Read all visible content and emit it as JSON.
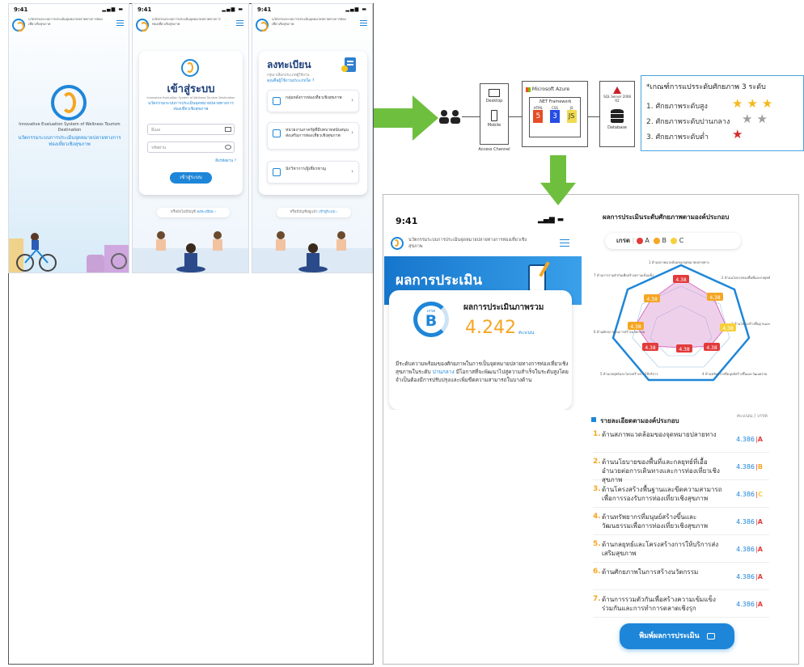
{
  "phone1": {
    "time": "9:41",
    "app_name": "นวัตกรรมระบบการประเมินจุดหมายปลายทางการท่องเที่ยวเชิงสุขภาพ",
    "system_en": "Innovative Evaluation System of Wellness Tourism Destination",
    "system_th": "นวัตกรรมระบบการประเมินจุดหมายปลายทางการท่องเที่ยวเชิงสุขภาพ"
  },
  "phone2": {
    "time": "9:41",
    "title": "เข้าสู่ระบบ",
    "subtitle_en": "Innovative Evaluation System of Wellness Tourism Destination",
    "subtitle_th": "นวัตกรรมระบบการประเมินจุดหมายปลายทางการท่องเที่ยวเชิงสุขภาพ",
    "email_placeholder": "อีเมล",
    "password_placeholder": "รหัสผ่าน",
    "forgot": "ลืมรหัสผ่าน ?",
    "login_button": "เข้าสู่ระบบ",
    "register_prompt": "หรือยังไม่มีบัญชี",
    "register_link": "ลงทะเบียน"
  },
  "phone3": {
    "time": "9:41",
    "title": "ลงทะเบียน",
    "subtitle": "กรุณาเลือกประเภทผู้ใช้งาน",
    "question": "คุณคือผู้ใช้งานประเภทใด ?",
    "options": [
      "กลุ่มหลังการท่องเที่ยวเชิงสุขภาพ",
      "หน่วยงานภาครัฐที่มีบทบาทสนับสนุน ส่งเสริมการท่องเที่ยวเชิงสุขภาพ",
      "นักวิชาการ/ผู้เชี่ยวชาญ"
    ],
    "login_prompt": "หรือมีบัญชีอยู่แล้ว",
    "login_link": "เข้าสู่ระบบ"
  },
  "architecture": {
    "desktop": "Desktop",
    "mobile": "Mobile",
    "access_channel": "Access Channel",
    "azure": "Microsoft Azure",
    "net": ".NET Framework",
    "html": "HTML",
    "css": "CSS",
    "js": "JS",
    "sql": "SQL Server 2008 R2",
    "database": "Database"
  },
  "legend": {
    "title": "*เกณฑ์การแปรระดับศักยภาพ 3 ระดับ",
    "levels": [
      "1. ศักยภาพระดับสูง",
      "2. ศักยภาพระดับปานกลาง",
      "3. ศักยภาพระดับต่ำ"
    ],
    "colors": {
      "gold": "#f5b81c",
      "gray": "#9e9e9e",
      "red": "#d62b2b"
    }
  },
  "result_phone": {
    "time": "9:41",
    "app_name": "นวัตกรรมระบบการประเมินจุดหมายปลายทางการท่องเที่ยวเชิงสุขภาพ",
    "banner": "ผลการประเมิน",
    "grade_label": "เกรด",
    "grade": "B",
    "overall_title": "ผลการประเมินภาพรวม",
    "score": "4.242",
    "unit": "คะแนน",
    "description_1": "มีระดับความพร้อมของศักยภาพในการเป็นจุดหมายปลายทางการท่องเที่ยวเชิงสุขภาพในระดับ",
    "description_level": "ปานกลาง",
    "description_2": "มีโอกาสที่จะพัฒนาไปสู่ความสำเร็จในระดับสูงโดยจำเป็นต้องมีการปรับปรุงและเพิ่มขีดความสามารถในบางด้าน"
  },
  "component": {
    "title": "ผลการประเมินระดับศักยภาพตามองค์ประกอบ",
    "grade_label": "เกรด",
    "grades": [
      "A",
      "B",
      "C"
    ],
    "grade_colors": [
      "#e23b3b",
      "#f5a623",
      "#f7d03c"
    ],
    "radar_labels": [
      "1 ด้านสภาพแวดล้อมของจุดหมายปลายทาง",
      "2 ด้านนโยบายของพื้นที่และกลยุทธ์ที่เอื้อต่อ",
      "3 ด้านโครงสร้างพื้นฐานและขีดความสามารถ",
      "4 ด้านทรัพยากรที่มนุษย์สร้างขึ้นและวัฒนธรรม",
      "5 ด้านกลยุทธ์และโครงสร้างการให้บริการ",
      "6 ด้านศักยภาพในการสร้างนวัตกรรม",
      "7 ด้านการรวมตัวกันเพื่อสร้างความเข้มแข็ง"
    ],
    "radar_values": [
      "4.38",
      "4.38",
      "4.38",
      "4.38",
      "4.38",
      "4.38",
      "4.38",
      "4.38"
    ],
    "detail_title": "รายละเอียดตามองค์ประกอบ",
    "detail_header": "คะแนน / เกรด",
    "rows": [
      {
        "num": "1.",
        "text": "ด้านสภาพแวดล้อมของจุดหมายปลายทาง",
        "score": "4.386",
        "grade": "A"
      },
      {
        "num": "2.",
        "text": "ด้านนโยบายของพื้นที่และกลยุทธ์ที่เอื้ออำนวยต่อการเดินทางและการท่องเที่ยวเชิงสุขภาพ",
        "score": "4.386",
        "grade": "B"
      },
      {
        "num": "3.",
        "text": "ด้านโครงสร้างพื้นฐานและขีดความสามารถเพื่อการรองรับการท่องเที่ยวเชิงสุขภาพ",
        "score": "4.386",
        "grade": "C"
      },
      {
        "num": "4.",
        "text": "ด้านทรัพยากรที่มนุษย์สร้างขึ้นและวัฒนธรรมเพื่อการท่องเที่ยวเชิงสุขภาพ",
        "score": "4.386",
        "grade": "A"
      },
      {
        "num": "5.",
        "text": "ด้านกลยุทธ์และโครงสร้างการให้บริการส่งเสริมสุขภาพ",
        "score": "4.386",
        "grade": "A"
      },
      {
        "num": "6.",
        "text": "ด้านศักยภาพในการสร้างนวัตกรรม",
        "score": "4.386",
        "grade": "A"
      },
      {
        "num": "7.",
        "text": "ด้านการรวมตัวกันเพื่อสร้างความเข้มแข็งร่วมกันและการทำการตลาดเชิงรุก",
        "score": "4.386",
        "grade": "A"
      }
    ],
    "print_button": "พิมพ์ผลการประเมิน"
  }
}
